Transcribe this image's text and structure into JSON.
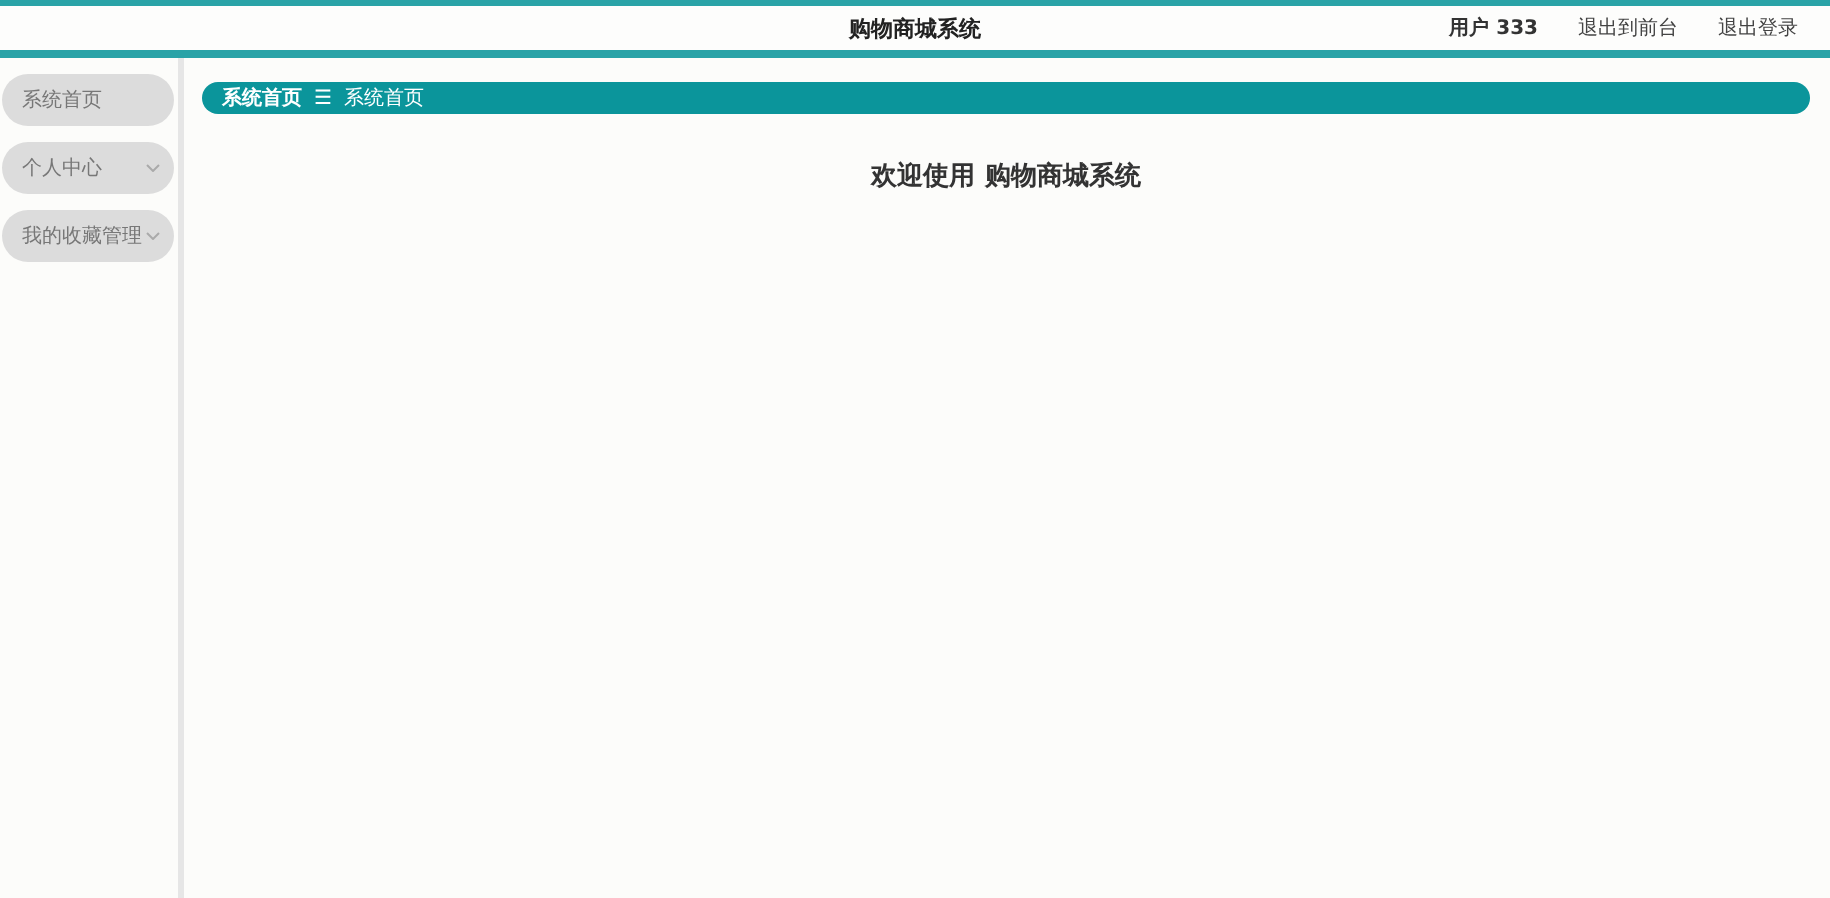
{
  "header": {
    "title": "购物商城系统",
    "user": "用户 333",
    "links": [
      "退出到前台",
      "退出登录"
    ]
  },
  "sidebar": {
    "items": [
      {
        "label": "系统首页",
        "expandable": false
      },
      {
        "label": "个人中心",
        "expandable": true
      },
      {
        "label": "我的收藏管理",
        "expandable": true
      }
    ]
  },
  "breadcrumb": {
    "items": [
      "系统首页",
      "系统首页"
    ],
    "separator": "☰"
  },
  "welcome": "欢迎使用 购物商城系统"
}
